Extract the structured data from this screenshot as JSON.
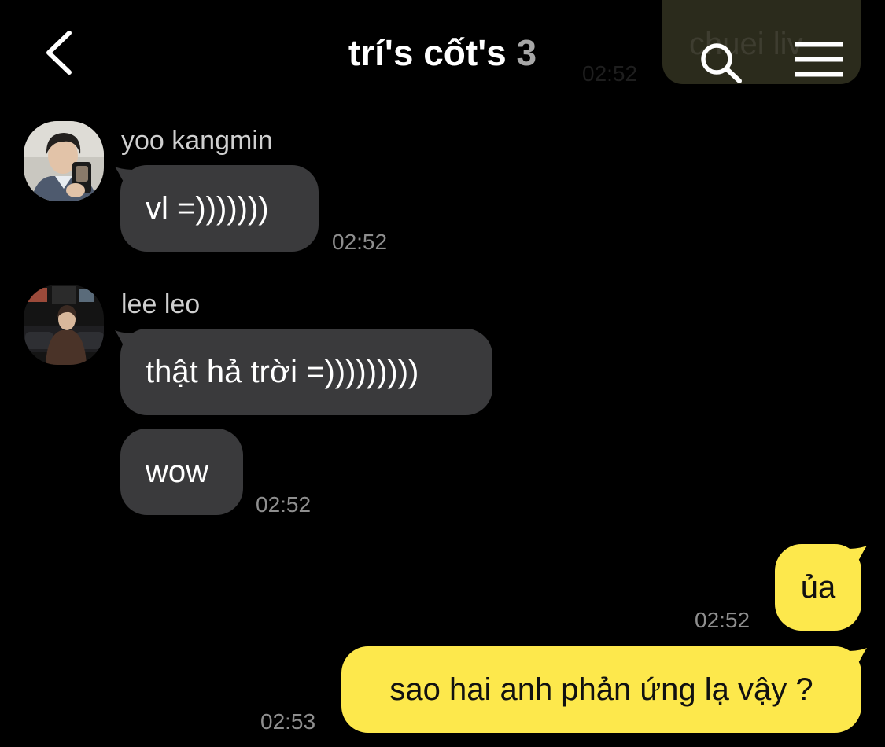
{
  "header": {
    "title": "trí's cốt's",
    "member_count": "3",
    "back_icon": "chevron-left-icon",
    "search_icon": "search-icon",
    "menu_icon": "hamburger-menu-icon"
  },
  "ghost": {
    "partial_text": "chuei liv",
    "time": "02:52"
  },
  "messages": [
    {
      "sender": "yoo kangmin",
      "direction": "incoming",
      "bubbles": [
        "vl =)))))))"
      ],
      "time": "02:52"
    },
    {
      "sender": "lee leo",
      "direction": "incoming",
      "bubbles": [
        "thật hả trời =)))))))))",
        "wow"
      ],
      "time": "02:52"
    },
    {
      "sender": "",
      "direction": "outgoing",
      "bubbles": [
        "ủa"
      ],
      "time": "02:52"
    },
    {
      "sender": "",
      "direction": "outgoing",
      "bubbles": [
        "sao hai anh phản ứng lạ vậy ?"
      ],
      "time": "02:53"
    }
  ],
  "colors": {
    "background": "#000000",
    "incoming_bubble": "#3a3a3c",
    "outgoing_bubble": "#fde84c",
    "timestamp": "#8e8e8e",
    "sender_name": "#cfcfcf"
  }
}
